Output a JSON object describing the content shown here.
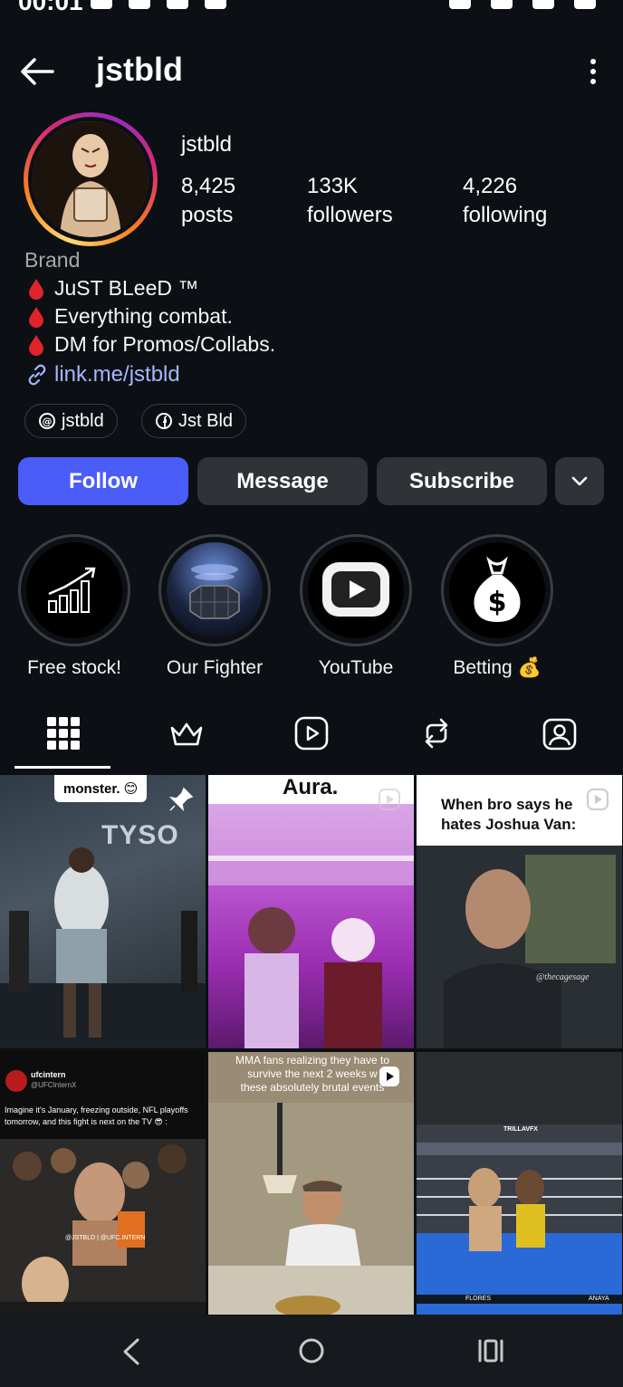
{
  "status_bar": {
    "time": "00:01"
  },
  "header": {
    "title": "jstbld"
  },
  "profile": {
    "username": "jstbld",
    "stats": [
      {
        "value": "8,425",
        "label": "posts"
      },
      {
        "value": "133K",
        "label": "followers"
      },
      {
        "value": "4,226",
        "label": "following"
      }
    ],
    "category": "Brand",
    "bio": [
      "JuST BLeeD ™",
      "Everything combat.",
      "DM for Promos/Collabs."
    ],
    "link": "link.me/jstbld",
    "threads_label": "jstbld",
    "facebook_label": "Jst Bld"
  },
  "actions": {
    "follow": "Follow",
    "message": "Message",
    "subscribe": "Subscribe"
  },
  "highlights": [
    {
      "label": "Free stock!"
    },
    {
      "label": "Our Fighter"
    },
    {
      "label": "YouTube"
    },
    {
      "label": "Betting 💰"
    }
  ],
  "tabs": [
    "grid-icon",
    "crown-icon",
    "reels-icon",
    "reposts-icon",
    "tagged-icon"
  ],
  "posts": [
    {
      "caption": "monster. 😊",
      "overlay": "TYSO"
    },
    {
      "caption": "Aura."
    },
    {
      "caption_line1": "When bro says he",
      "caption_line2": "hates Joshua Van:",
      "watermark": "@thecagesage"
    },
    {
      "account": "ufcintern",
      "handle": "@UFCInternX",
      "text_line1": "Imagine it's January, freezing outside, NFL playoffs",
      "text_line2": "tomorrow, and this fight is next on the TV 😎 :",
      "credit": "@JSTBLD | @UFC.INTERN"
    },
    {
      "caption_line1": "MMA fans realizing they have to",
      "caption_line2": "survive the next 2 weeks w",
      "caption_line3": "these absolutely brutal events"
    },
    {
      "brand": "TRILLAVFX",
      "score_left": "FLORES",
      "score_right": "ANAYA"
    }
  ],
  "colors": {
    "follow": "#4a5df9",
    "background": "#0c1014",
    "link": "#a3b7ff"
  }
}
